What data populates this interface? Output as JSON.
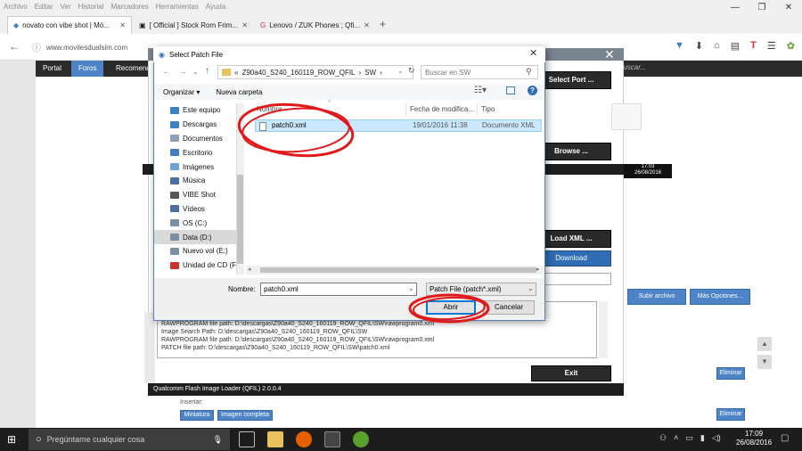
{
  "browser": {
    "menu": [
      "Archivo",
      "Editar",
      "Ver",
      "Historial",
      "Marcadores",
      "Herramientas",
      "Ayuda"
    ],
    "tabs": [
      {
        "label": "novato con vibe shot | Mó...",
        "active": true
      },
      {
        "label": "[ Official ] Stock Rom Frim...",
        "active": false
      },
      {
        "label": "Lenovo / ZUK Phones ; Qfi...",
        "active": false
      }
    ],
    "url": "www.movilesdualsim.com"
  },
  "site": {
    "nav": [
      "Portal",
      "Foros",
      "Recomend"
    ],
    "search_placeholder": "Buscar..."
  },
  "qfil": {
    "select_port": "Select Port ...",
    "browse": "Browse ...",
    "load_xml": "Load XML ...",
    "download": "Download",
    "exit": "Exit",
    "footer": "Qualcomm Flash Image Loader (QFIL)    2.0.0.4",
    "log": [
      "RAWPROGRAM file path: D:\\descargas\\Z90a40_S240_160119_ROW_QFIL\\SW\\rawprogram0.xml",
      "Image Search Path: D:\\descargas\\Z90a40_S240_160119_ROW_QFIL\\SW",
      "RAWPROGRAM file path: D:\\descargas\\Z90a40_S240_160119_ROW_QFIL\\SW\\rawprogram0.xml",
      "PATCH file path: D:\\descargas\\Z90a40_S240_160119_ROW_QFIL\\SW\\patch0.xml"
    ],
    "timestamp_time": "17:03",
    "timestamp_date": "26/08/2016"
  },
  "forum": {
    "upload_button": "Subir archivo",
    "more_options": "Más Opciones...",
    "delete_1": "Eliminar",
    "delete_2": "Eliminar",
    "insert_label": "Insertar:",
    "thumbnail": "Miniatura",
    "full_image": "Imagen completa"
  },
  "dialog": {
    "title": "Select Patch File",
    "path": [
      "«",
      "Z90a40_S240_160119_ROW_QFIL",
      "›",
      "SW",
      "›"
    ],
    "search_placeholder": "Buscar en SW",
    "organize": "Organizar ▾",
    "new_folder": "Nueva carpeta",
    "nav_items": [
      {
        "label": "Este equipo",
        "icon": "computer-icon",
        "color": "#3c7fc4"
      },
      {
        "label": "Descargas",
        "icon": "download-folder-icon",
        "color": "#3c7fc4"
      },
      {
        "label": "Documentos",
        "icon": "documents-icon",
        "color": "#8aa0b8"
      },
      {
        "label": "Escritorio",
        "icon": "desktop-icon",
        "color": "#3c7fc4"
      },
      {
        "label": "Imágenes",
        "icon": "pictures-icon",
        "color": "#6ba3d6"
      },
      {
        "label": "Música",
        "icon": "music-icon",
        "color": "#4a6fa5"
      },
      {
        "label": "VIBE Shot",
        "icon": "phone-icon",
        "color": "#555555"
      },
      {
        "label": "Vídeos",
        "icon": "videos-icon",
        "color": "#4a6fa5"
      },
      {
        "label": "OS (C:)",
        "icon": "drive-icon",
        "color": "#7a8ea6"
      },
      {
        "label": "Data (D:)",
        "icon": "drive-icon",
        "color": "#7a8ea6",
        "selected": true
      },
      {
        "label": "Nuevo vol (E:)",
        "icon": "drive-icon",
        "color": "#7a8ea6"
      },
      {
        "label": "Unidad de CD (F",
        "icon": "cd-drive-icon",
        "color": "#d0312d"
      }
    ],
    "columns": [
      "Nombre",
      "Fecha de modifica...",
      "Tipo"
    ],
    "files": [
      {
        "name": "patch0.xml",
        "date": "19/01/2016 11:38",
        "type": "Documento XML"
      }
    ],
    "filename_label": "Nombre:",
    "filename_value": "patch0.xml",
    "filter": "Patch File (patch*.xml)",
    "open_button": "Abrir",
    "cancel_button": "Cancelar"
  },
  "taskbar": {
    "search_placeholder": "Pregúntame cualquier cosa",
    "time": "17:09",
    "date": "26/08/2016"
  },
  "colors": {
    "accent": "#4c84c7",
    "annotation_red": "#e01a1a",
    "selection": "#cce8ff"
  }
}
